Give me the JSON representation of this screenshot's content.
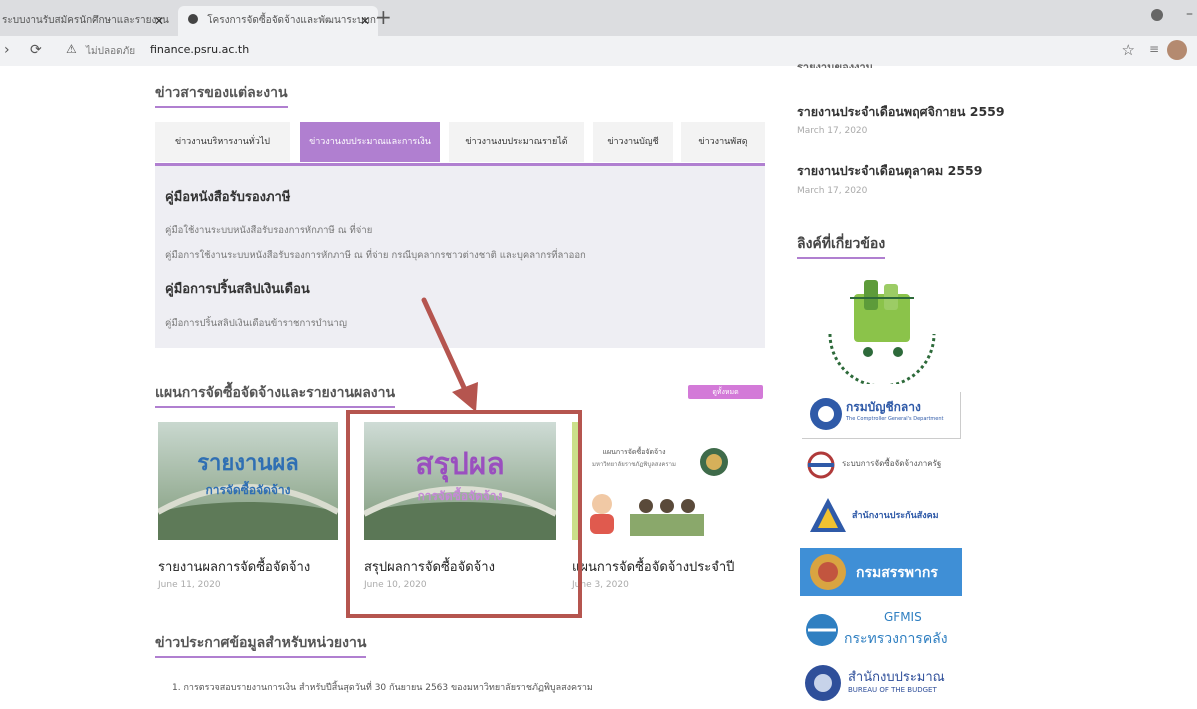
{
  "browser": {
    "tab1_title": "ระบบงานรับสมัครนักศึกษาและรายงาน PSR",
    "tab2_title": "โครงการจัดซื้อจัดจ้างและพัฒนาระบบการเงิน",
    "new_tab": "+",
    "not_secure": "ไม่ปลอดภัย",
    "url": "finance.psru.ac.th"
  },
  "main": {
    "news_section_title": "ข่าวสารของแต่ละงาน",
    "tabs": [
      {
        "label": "ข่าวงานบริหารงานทั่วไป"
      },
      {
        "label": "ข่าวงานงบประมาณและการเงิน"
      },
      {
        "label": "ข่าวงานงบประมาณรายได้"
      },
      {
        "label": "ข่าวงานบัญชี"
      },
      {
        "label": "ข่าวงานพัสดุ"
      }
    ],
    "panel": {
      "heading1": "คู่มือหนังสือรับรองภาษี",
      "link1": "คู่มือใช้งานระบบหนังสือรับรองการหักภาษี ณ ที่จ่าย",
      "link2": "คู่มือการใช้งานระบบหนังสือรับรองการหักภาษี ณ ที่จ่าย กรณีบุคลากรชาวต่างชาติ และบุคลากรที่ลาออก",
      "heading2": "คู่มือการปริ้นสลิปเงินเดือน",
      "link3": "คู่มือการปริ้นสลิปเงินเดือนข้าราชการบำนาญ"
    },
    "procurement_section_title": "แผนการจัดซื้อจัดจ้างและรายงานผลงาน",
    "more_button": "ดูทั้งหมด",
    "cards": [
      {
        "img_line1": "รายงานผล",
        "img_line2": "การจัดซื้อจัดจ้าง",
        "title": "รายงานผลการจัดซื้อจัดจ้าง",
        "date": "June 11, 2020"
      },
      {
        "img_line1": "สรุปผล",
        "img_line2": "การจัดซื้อจัดจ้าง",
        "title": "สรุปผลการจัดซื้อจัดจ้าง",
        "date": "June 10, 2020"
      },
      {
        "img_line1": "แผนการจัดซื้อจัดจ้าง",
        "img_line2": "มหาวิทยาลัยราชภัฏพิบูลสงคราม",
        "title": "แผนการจัดซื้อจัดจ้างประจำปี",
        "date": "June 3, 2020"
      }
    ],
    "announce_section_title": "ข่าวประกาศข้อมูลสำหรับหน่วยงาน",
    "announce_item1": "1. การตรวจสอบรายงานการเงิน สำหรับปีสิ้นสุดวันที่ 30 กันยายน 2563 ของมหาวิทยาลัยราชภัฏพิบูลสงคราม"
  },
  "sidebar": {
    "cut_heading": "รายงานของงาน",
    "reports": [
      {
        "title": "รายงานประจำเดือนพฤศจิกายน 2559",
        "date": "March 17, 2020"
      },
      {
        "title": "รายงานประจำเดือนตุลาคม 2559",
        "date": "March 17, 2020"
      }
    ],
    "links_title": "ลิงค์ที่เกี่ยวข้อง",
    "logos": {
      "cgd": "กรมบัญชีกลาง",
      "cgd_en": "The Comptroller General's Department",
      "egp": "ระบบการจัดซื้อจัดจ้างภาครัฐ",
      "sso": "สำนักงานประกันสังคม",
      "rd": "กรมสรรพากร",
      "gfmis": "GFMIS",
      "mof": "กระทรวงการคลัง",
      "bb": "สำนักงบประมาณ",
      "bb_en": "BUREAU OF THE BUDGET"
    }
  },
  "colors": {
    "accent": "#b07fd0",
    "annotation": "#b5554f",
    "more_button": "#d37ad8"
  }
}
